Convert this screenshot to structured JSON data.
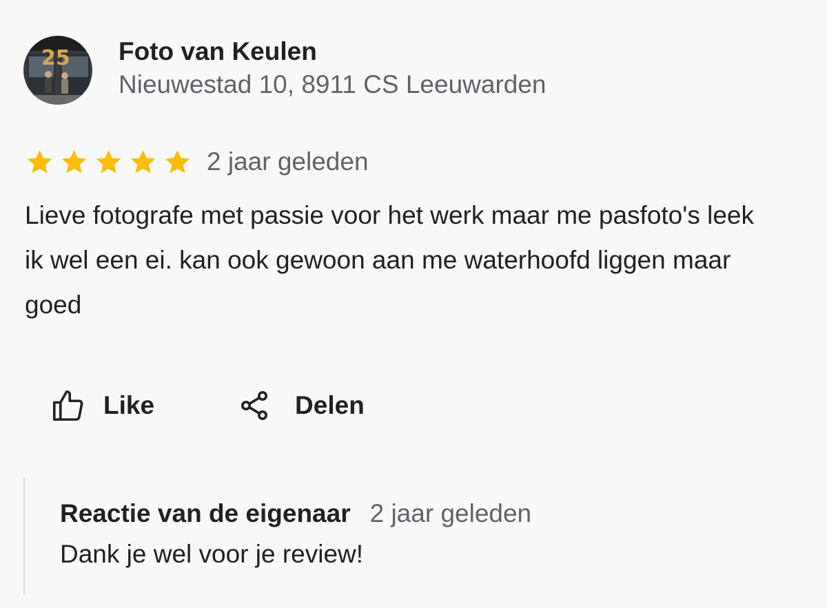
{
  "business": {
    "name": "Foto van Keulen",
    "address": "Nieuwestad 10, 8911 CS Leeuwarden",
    "avatar": {
      "alt_icon": "storefront-photo",
      "photo_sign_text": "25"
    }
  },
  "review": {
    "rating": 5,
    "max_rating": 5,
    "star_color": "#fbbc04",
    "time_ago": "2 jaar geleden",
    "text": "Lieve fotografe met passie voor het werk maar me pasfoto's leek ik wel een ei. kan ook gewoon aan me waterhoofd liggen maar goed"
  },
  "actions": {
    "like_label": "Like",
    "like_icon": "thumbs-up-icon",
    "share_label": "Delen",
    "share_icon": "share-icon"
  },
  "owner_reply": {
    "title": "Reactie van de eigenaar",
    "time_ago": "2 jaar geleden",
    "text": "Dank je wel voor je review!"
  }
}
